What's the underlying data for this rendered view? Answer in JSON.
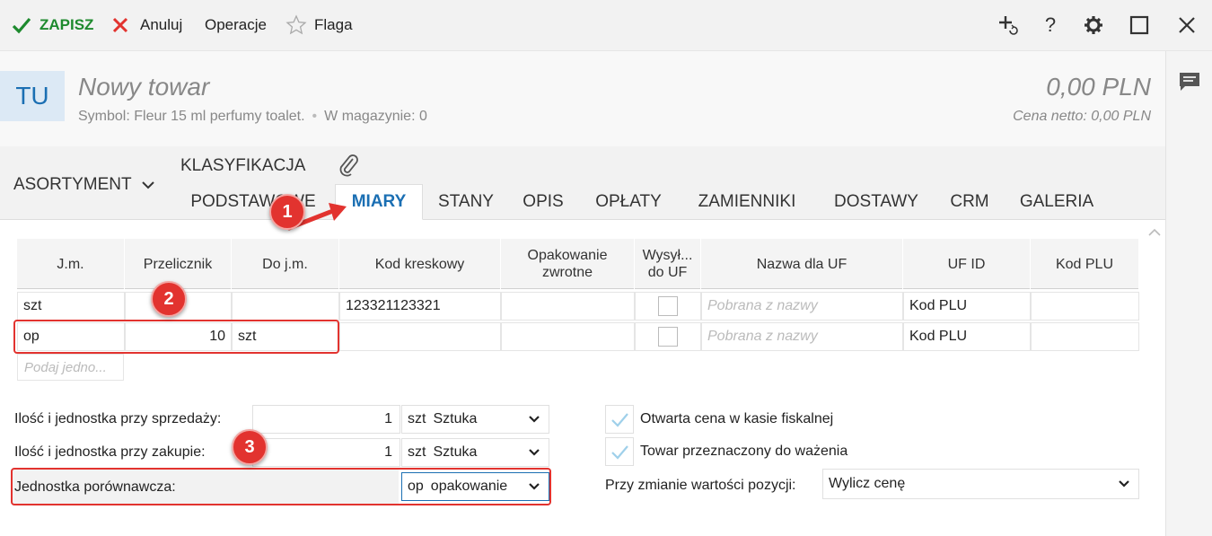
{
  "toolbar": {
    "save_label": "ZAPISZ",
    "cancel_label": "Anuluj",
    "operations_label": "Operacje",
    "flag_label": "Flaga"
  },
  "header": {
    "badge": "TU",
    "name": "Nowy towar",
    "symbol": "Symbol: Fleur 15 ml perfumy toalet.",
    "stock": "W magazynie: 0",
    "price": "0,00 PLN",
    "net_price": "Cena netto: 0,00 PLN"
  },
  "tabs": {
    "assortment": "ASORTYMENT",
    "classification": "KLASYFIKACJA",
    "items": [
      {
        "label": "PODSTAWOWE"
      },
      {
        "label": "MIARY"
      },
      {
        "label": "STANY"
      },
      {
        "label": "OPIS"
      },
      {
        "label": "OPŁATY"
      },
      {
        "label": "ZAMIENNIKI"
      },
      {
        "label": "DOSTAWY"
      },
      {
        "label": "CRM"
      },
      {
        "label": "GALERIA"
      }
    ],
    "active": "MIARY"
  },
  "grid": {
    "headers": [
      "J.m.",
      "Przelicznik",
      "Do j.m.",
      "Kod kreskowy",
      "Opakowanie zwrotne",
      "Wysył... do UF",
      "Nazwa dla UF",
      "UF ID",
      "Kod PLU"
    ],
    "rows": [
      {
        "jm": "szt",
        "przelicznik": "",
        "do_jm": "",
        "kod": "123321123321",
        "nazwa_placeholder": "Pobrana z nazwy",
        "uf_id": "Kod PLU"
      },
      {
        "jm": "op",
        "przelicznik": "10",
        "do_jm": "szt",
        "kod": "",
        "nazwa_placeholder": "Pobrana z nazwy",
        "uf_id": "Kod PLU"
      }
    ],
    "new_row_placeholder": "Podaj jedno..."
  },
  "form": {
    "sale_label": "Ilość i jednostka przy sprzedaży:",
    "sale_qty": "1",
    "sale_unit_symbol": "szt",
    "sale_unit_name": "Sztuka",
    "purchase_label": "Ilość i jednostka przy zakupie:",
    "purchase_qty": "1",
    "purchase_unit_symbol": "szt",
    "purchase_unit_name": "Sztuka",
    "compare_label": "Jednostka porównawcza:",
    "compare_unit_symbol": "op",
    "compare_unit_name": "opakowanie",
    "open_price_label": "Otwarta cena w kasie fiskalnej",
    "weighing_label": "Towar przeznaczony do ważenia",
    "value_change_label": "Przy zmianie wartości pozycji:",
    "value_change_option": "Wylicz cenę"
  },
  "annotations": [
    "1",
    "2",
    "3"
  ],
  "colors": {
    "accent": "#1b6fb3",
    "save_green": "#1e8a2e",
    "annotation_red": "#e2332f"
  }
}
